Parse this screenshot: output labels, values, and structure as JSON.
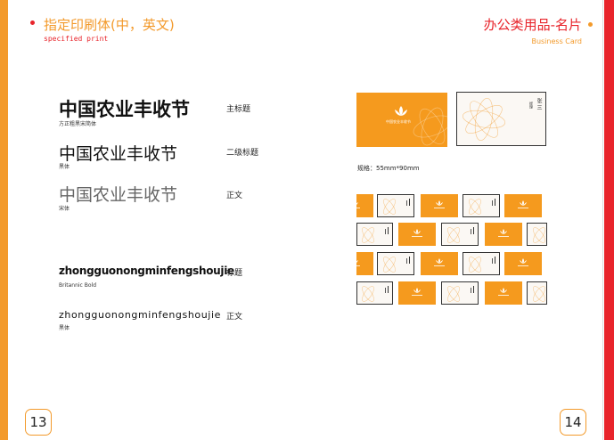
{
  "left_page": {
    "title": "指定印刷体(中，英文)",
    "subtitle": "specified print",
    "page_number": "13",
    "samples": [
      {
        "text": "中国农业丰收节",
        "caption": "方正粗黑宋简体",
        "label": "主标题"
      },
      {
        "text": "中国农业丰收节",
        "caption": "黑体",
        "label": "二级标题"
      },
      {
        "text": "中国农业丰收节",
        "caption": "宋体",
        "label": "正文"
      },
      {
        "text": "zhongguonongminfengshoujie",
        "caption": "Britannic Bold",
        "label": "标题"
      },
      {
        "text": "zhongguonongminfengshoujie",
        "caption": "黑体",
        "label": "正文"
      }
    ]
  },
  "right_page": {
    "title": "办公类用品-名片",
    "subtitle": "Business Card",
    "page_number": "14",
    "spec": "规格：55mm*90mm",
    "card_front_text": "中国农业丰收节",
    "card_back_name": "张 三",
    "card_back_title": "经理"
  },
  "colors": {
    "orange": "#f39a2b",
    "red": "#e8242b"
  }
}
